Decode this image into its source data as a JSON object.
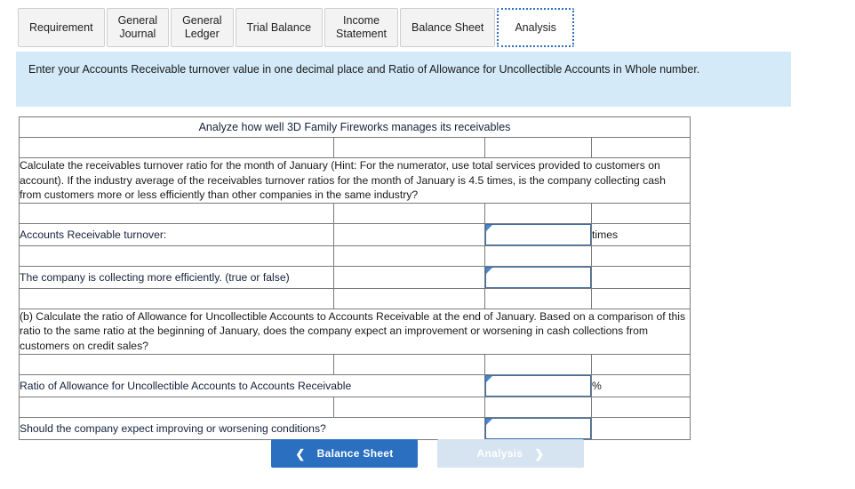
{
  "tabs": [
    {
      "label": "Requirement",
      "active": false
    },
    {
      "label": "General\nJournal",
      "active": false
    },
    {
      "label": "General\nLedger",
      "active": false
    },
    {
      "label": "Trial Balance",
      "active": false
    },
    {
      "label": "Income\nStatement",
      "active": false
    },
    {
      "label": "Balance Sheet",
      "active": false
    },
    {
      "label": "Analysis",
      "active": true
    }
  ],
  "banner": {
    "text": "Enter your Accounts Receivable turnover value in one decimal place and Ratio of Allowance for Uncollectible Accounts in Whole number."
  },
  "sheet": {
    "title": "Analyze how well 3D Family Fireworks manages its receivables",
    "question_a": "Calculate the receivables turnover ratio for the month of January (Hint: For the numerator, use total services provided to customers on account). If the industry average of the receivables turnover ratios for the month of January is 4.5 times, is the company collecting cash from customers more or less efficiently than other companies in the same industry?",
    "row_turnover_label": "Accounts Receivable turnover:",
    "row_turnover_value": "",
    "row_turnover_unit": "times",
    "row_efficiency_label": "The company is collecting more efficiently. (true or false)",
    "row_efficiency_value": "",
    "question_b": "(b) Calculate the ratio of Allowance for Uncollectible Accounts to Accounts Receivable at the end of January. Based on a comparison of this ratio to the same ratio at the beginning of January, does the company expect an improvement or worsening in cash collections from customers on credit sales?",
    "row_ratio_label": "Ratio of Allowance for Uncollectible Accounts to Accounts Receivable",
    "row_ratio_value": "",
    "row_ratio_unit": "%",
    "row_conditions_label": "Should the company expect improving or worsening conditions?",
    "row_conditions_value": ""
  },
  "nav": {
    "prev_label": "Balance Sheet",
    "prev_icon": "chevron-left-icon",
    "next_label": "Analysis",
    "next_icon": "chevron-right-icon"
  },
  "colors": {
    "header_blue": "#6ba4e3",
    "banner_blue": "#d4eaf8",
    "button_blue": "#2a6fc0",
    "button_disabled": "#d6e3f0",
    "input_border": "#3b6ea8",
    "grid_line": "#7a7a7a"
  }
}
